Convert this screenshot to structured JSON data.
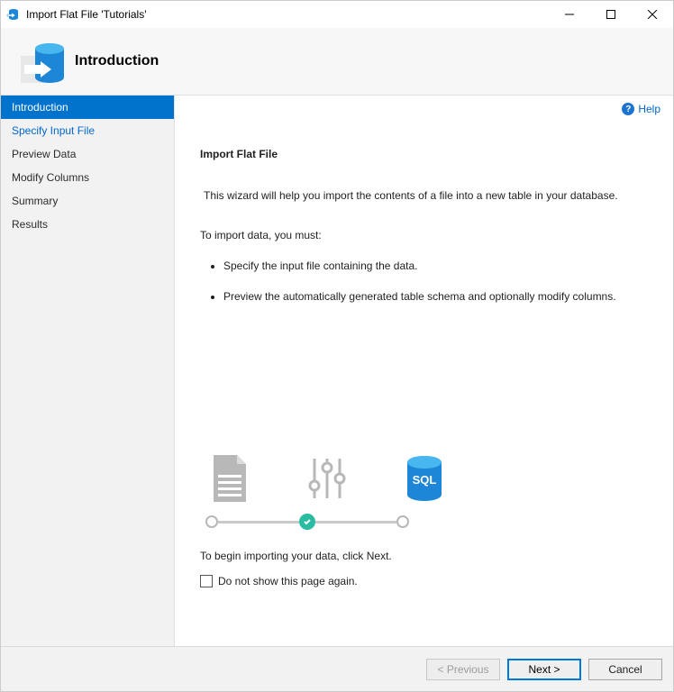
{
  "window": {
    "title": "Import Flat File 'Tutorials'"
  },
  "header": {
    "title": "Introduction"
  },
  "sidebar": {
    "steps": [
      {
        "label": "Introduction",
        "state": "active"
      },
      {
        "label": "Specify Input File",
        "state": "link"
      },
      {
        "label": "Preview Data",
        "state": "other"
      },
      {
        "label": "Modify Columns",
        "state": "other"
      },
      {
        "label": "Summary",
        "state": "other"
      },
      {
        "label": "Results",
        "state": "other"
      }
    ]
  },
  "help": {
    "label": "Help"
  },
  "content": {
    "section_title": "Import Flat File",
    "intro": "This wizard will help you import the contents of a file into a new table in your database.",
    "must_heading": "To import data, you must:",
    "bullet1": "Specify the input file containing the data.",
    "bullet2": "Preview the automatically generated table schema and optionally modify columns.",
    "begin": "To begin importing your data, click Next.",
    "checkbox_label": "Do not show this page again."
  },
  "footer": {
    "previous": "< Previous",
    "next": "Next >",
    "cancel": "Cancel"
  }
}
